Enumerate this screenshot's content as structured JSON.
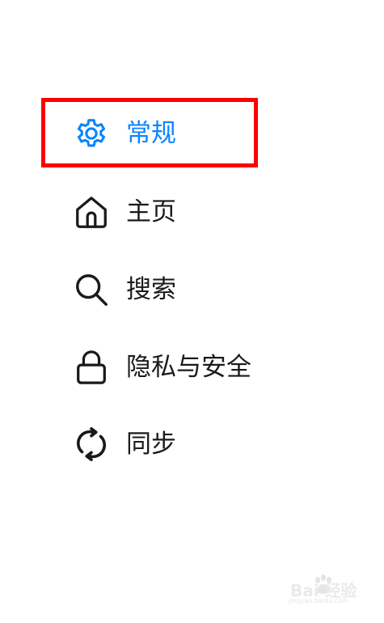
{
  "menu": {
    "items": [
      {
        "label": "常规",
        "icon": "gear-icon",
        "active": true
      },
      {
        "label": "主页",
        "icon": "home-icon",
        "active": false
      },
      {
        "label": "搜索",
        "icon": "search-icon",
        "active": false
      },
      {
        "label": "隐私与安全",
        "icon": "lock-icon",
        "active": false
      },
      {
        "label": "同步",
        "icon": "sync-icon",
        "active": false
      }
    ]
  },
  "watermark": {
    "text": "Bai 经验",
    "sub": "jingyan.baidu.com"
  },
  "colors": {
    "active": "#0a84ff",
    "text": "#1a1a1a",
    "highlight": "#ff0000"
  }
}
